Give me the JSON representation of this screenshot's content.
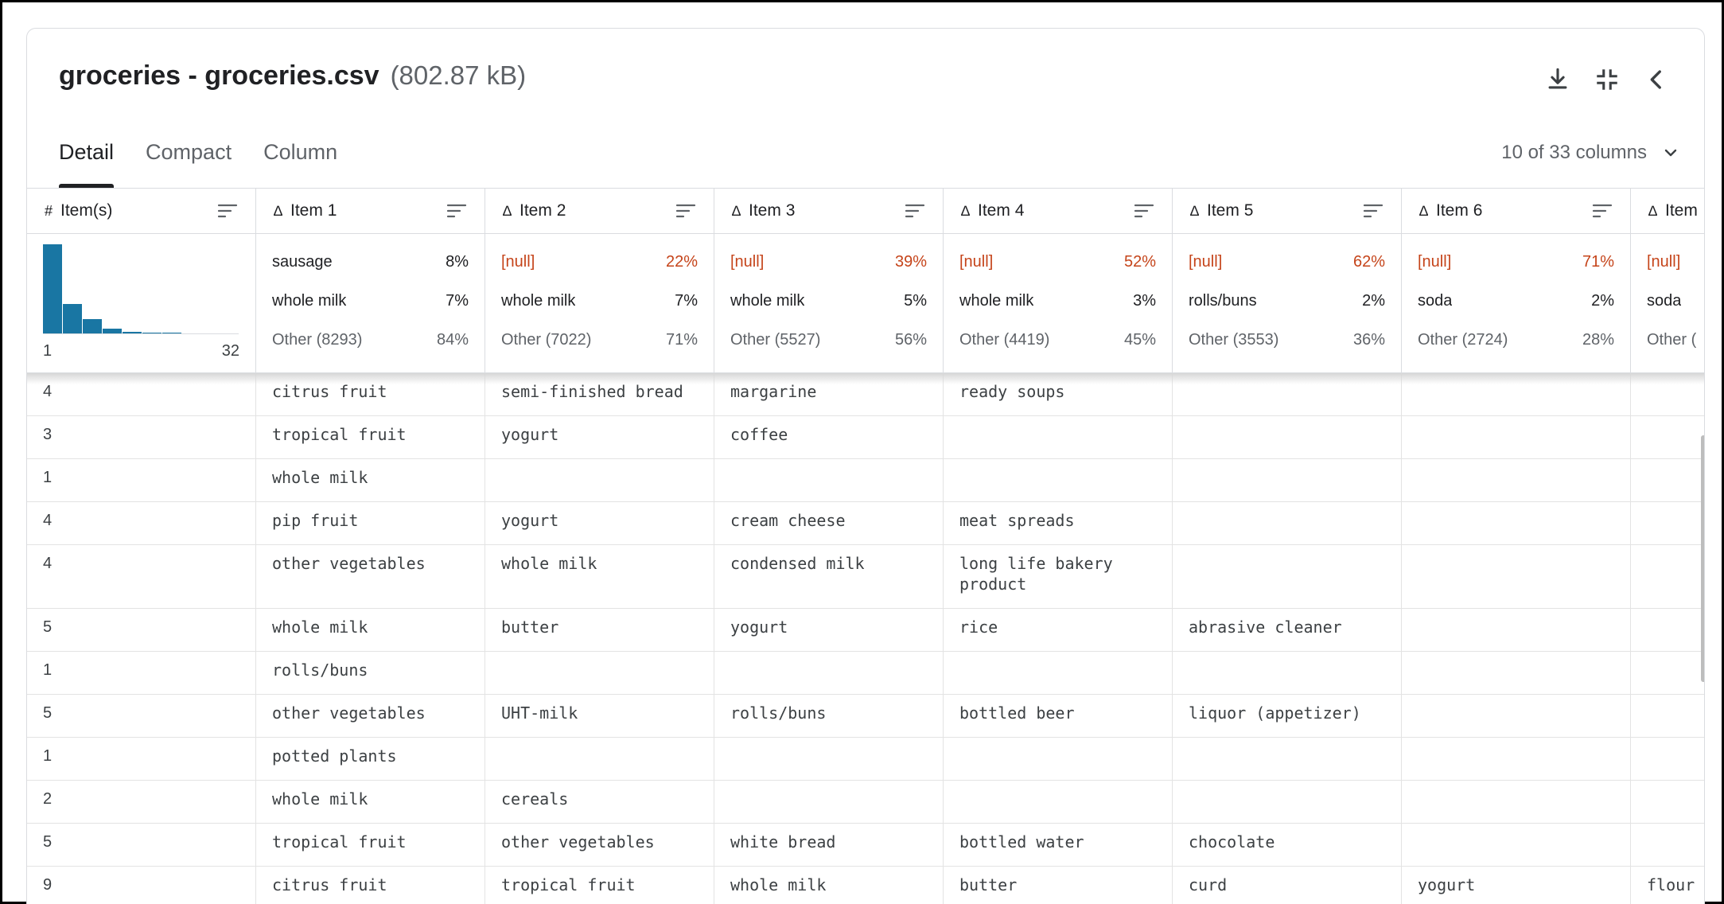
{
  "dataset": {
    "title": "groceries - groceries.csv",
    "size": "(802.87 kB)"
  },
  "tabs": [
    "Detail",
    "Compact",
    "Column"
  ],
  "column_selector": "10 of 33 columns",
  "columns": [
    {
      "type": "#",
      "name": "Item(s)"
    },
    {
      "type": "A",
      "name": "Item 1"
    },
    {
      "type": "A",
      "name": "Item 2"
    },
    {
      "type": "A",
      "name": "Item 3"
    },
    {
      "type": "A",
      "name": "Item 4"
    },
    {
      "type": "A",
      "name": "Item 5"
    },
    {
      "type": "A",
      "name": "Item 6"
    },
    {
      "type": "A",
      "name": "Item"
    }
  ],
  "histogram": {
    "min_label": "1",
    "max_label": "32",
    "relative_heights": [
      1.0,
      0.33,
      0.16,
      0.05,
      0.02,
      0.01,
      0.005
    ],
    "color": "#1976a3"
  },
  "summaries": [
    [
      {
        "label": "sausage",
        "pct": "8%",
        "kind": "value"
      },
      {
        "label": "whole milk",
        "pct": "7%",
        "kind": "value"
      },
      {
        "label": "Other (8293)",
        "pct": "84%",
        "kind": "other"
      }
    ],
    [
      {
        "label": "[null]",
        "pct": "22%",
        "kind": "null"
      },
      {
        "label": "whole milk",
        "pct": "7%",
        "kind": "value"
      },
      {
        "label": "Other (7022)",
        "pct": "71%",
        "kind": "other"
      }
    ],
    [
      {
        "label": "[null]",
        "pct": "39%",
        "kind": "null"
      },
      {
        "label": "whole milk",
        "pct": "5%",
        "kind": "value"
      },
      {
        "label": "Other (5527)",
        "pct": "56%",
        "kind": "other"
      }
    ],
    [
      {
        "label": "[null]",
        "pct": "52%",
        "kind": "null"
      },
      {
        "label": "whole milk",
        "pct": "3%",
        "kind": "value"
      },
      {
        "label": "Other (4419)",
        "pct": "45%",
        "kind": "other"
      }
    ],
    [
      {
        "label": "[null]",
        "pct": "62%",
        "kind": "null"
      },
      {
        "label": "rolls/buns",
        "pct": "2%",
        "kind": "value"
      },
      {
        "label": "Other (3553)",
        "pct": "36%",
        "kind": "other"
      }
    ],
    [
      {
        "label": "[null]",
        "pct": "71%",
        "kind": "null"
      },
      {
        "label": "soda",
        "pct": "2%",
        "kind": "value"
      },
      {
        "label": "Other (2724)",
        "pct": "28%",
        "kind": "other"
      }
    ],
    [
      {
        "label": "[null]",
        "pct": "",
        "kind": "null"
      },
      {
        "label": "soda",
        "pct": "",
        "kind": "value"
      },
      {
        "label": "Other (",
        "pct": "",
        "kind": "other"
      }
    ]
  ],
  "rows": [
    [
      "4",
      "citrus fruit",
      "semi-finished bread",
      "margarine",
      "ready soups",
      "",
      "",
      ""
    ],
    [
      "3",
      "tropical fruit",
      "yogurt",
      "coffee",
      "",
      "",
      "",
      ""
    ],
    [
      "1",
      "whole milk",
      "",
      "",
      "",
      "",
      "",
      ""
    ],
    [
      "4",
      "pip fruit",
      "yogurt",
      "cream cheese",
      "meat spreads",
      "",
      "",
      ""
    ],
    [
      "4",
      "other vegetables",
      "whole milk",
      "condensed milk",
      "long life bakery product",
      "",
      "",
      ""
    ],
    [
      "5",
      "whole milk",
      "butter",
      "yogurt",
      "rice",
      "abrasive cleaner",
      "",
      ""
    ],
    [
      "1",
      "rolls/buns",
      "",
      "",
      "",
      "",
      "",
      ""
    ],
    [
      "5",
      "other vegetables",
      "UHT-milk",
      "rolls/buns",
      "bottled beer",
      "liquor (appetizer)",
      "",
      ""
    ],
    [
      "1",
      "potted plants",
      "",
      "",
      "",
      "",
      "",
      ""
    ],
    [
      "2",
      "whole milk",
      "cereals",
      "",
      "",
      "",
      "",
      ""
    ],
    [
      "5",
      "tropical fruit",
      "other vegetables",
      "white bread",
      "bottled water",
      "chocolate",
      "",
      ""
    ],
    [
      "9",
      "citrus fruit",
      "tropical fruit",
      "whole milk",
      "butter",
      "curd",
      "yogurt",
      "flour"
    ]
  ]
}
